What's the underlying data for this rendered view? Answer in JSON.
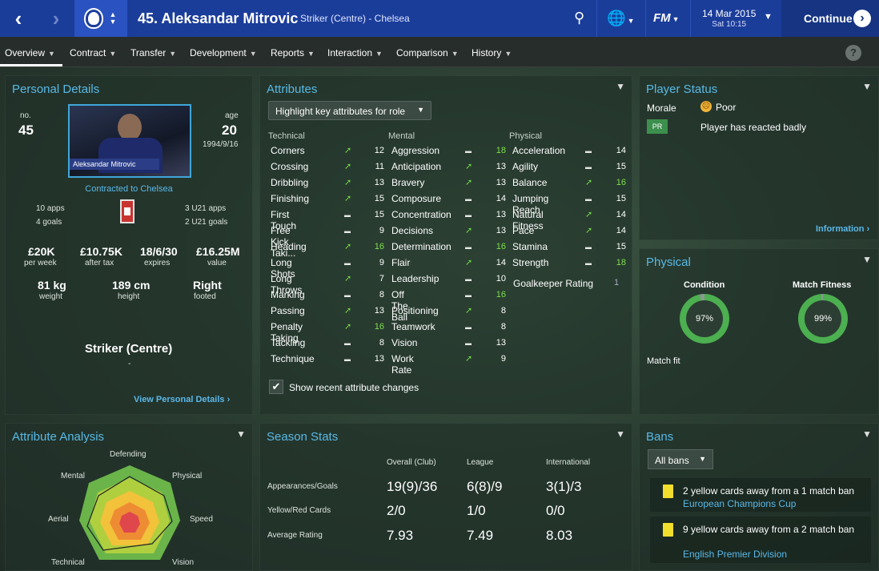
{
  "header": {
    "title": "45. Aleksandar Mitrovic",
    "subtitle": "Striker (Centre) - Chelsea",
    "date": "14 Mar 2015",
    "time": "Sat 10:15",
    "continue": "Continue",
    "fm": "FM"
  },
  "tabs": [
    {
      "label": "Overview"
    },
    {
      "label": "Contract"
    },
    {
      "label": "Transfer"
    },
    {
      "label": "Development"
    },
    {
      "label": "Reports"
    },
    {
      "label": "Interaction"
    },
    {
      "label": "Comparison"
    },
    {
      "label": "History"
    }
  ],
  "personal": {
    "title": "Personal Details",
    "no_label": "no.",
    "no": "45",
    "age_label": "age",
    "age": "20",
    "dob": "1994/9/16",
    "photo_caption": "Aleksandar Mitrovic",
    "contracted": "Contracted to Chelsea",
    "apps": "10 apps",
    "goals": "4 goals",
    "u21_apps": "3 U21 apps",
    "u21_goals": "2 U21 goals",
    "stats": [
      {
        "value": "£20K",
        "label": "per week"
      },
      {
        "value": "£10.75K",
        "label": "after tax"
      },
      {
        "value": "18/6/30",
        "label": "expires"
      },
      {
        "value": "£16.25M",
        "label": "value"
      }
    ],
    "body": [
      {
        "value": "81 kg",
        "label": "weight"
      },
      {
        "value": "189 cm",
        "label": "height"
      },
      {
        "value": "Right",
        "label": "footed"
      }
    ],
    "position": "Striker (Centre)",
    "dash": "-",
    "link": "View Personal Details ›"
  },
  "attributes": {
    "title": "Attributes",
    "dropdown": "Highlight key attributes for role",
    "technical_header": "Technical",
    "mental_header": "Mental",
    "physical_header": "Physical",
    "technical": [
      {
        "name": "Corners",
        "value": "12",
        "ind": "up"
      },
      {
        "name": "Crossing",
        "value": "11",
        "ind": "up"
      },
      {
        "name": "Dribbling",
        "value": "13",
        "ind": "up"
      },
      {
        "name": "Finishing",
        "value": "15",
        "ind": "up"
      },
      {
        "name": "First Touch",
        "value": "15",
        "ind": "dash"
      },
      {
        "name": "Free Kick Taki...",
        "value": "9",
        "ind": "dash"
      },
      {
        "name": "Heading",
        "value": "16",
        "ind": "up"
      },
      {
        "name": "Long Shots",
        "value": "9",
        "ind": "dash"
      },
      {
        "name": "Long Throws",
        "value": "7",
        "ind": "up"
      },
      {
        "name": "Marking",
        "value": "8",
        "ind": "dash"
      },
      {
        "name": "Passing",
        "value": "13",
        "ind": "up"
      },
      {
        "name": "Penalty Taking",
        "value": "16",
        "ind": "up"
      },
      {
        "name": "Tackling",
        "value": "8",
        "ind": "dash"
      },
      {
        "name": "Technique",
        "value": "13",
        "ind": "dash"
      }
    ],
    "mental": [
      {
        "name": "Aggression",
        "value": "18",
        "ind": "dash"
      },
      {
        "name": "Anticipation",
        "value": "13",
        "ind": "up"
      },
      {
        "name": "Bravery",
        "value": "13",
        "ind": "up"
      },
      {
        "name": "Composure",
        "value": "14",
        "ind": "dash"
      },
      {
        "name": "Concentration",
        "value": "13",
        "ind": "dash"
      },
      {
        "name": "Decisions",
        "value": "13",
        "ind": "up"
      },
      {
        "name": "Determination",
        "value": "16",
        "ind": "dash"
      },
      {
        "name": "Flair",
        "value": "14",
        "ind": "up"
      },
      {
        "name": "Leadership",
        "value": "10",
        "ind": "dash"
      },
      {
        "name": "Off The Ball",
        "value": "16",
        "ind": "dash"
      },
      {
        "name": "Positioning",
        "value": "8",
        "ind": "up"
      },
      {
        "name": "Teamwork",
        "value": "8",
        "ind": "dash"
      },
      {
        "name": "Vision",
        "value": "13",
        "ind": "dash"
      },
      {
        "name": "Work Rate",
        "value": "9",
        "ind": "up"
      }
    ],
    "physical": [
      {
        "name": "Acceleration",
        "value": "14",
        "ind": "dash"
      },
      {
        "name": "Agility",
        "value": "15",
        "ind": "dash"
      },
      {
        "name": "Balance",
        "value": "16",
        "ind": "up"
      },
      {
        "name": "Jumping Reach",
        "value": "15",
        "ind": "dash"
      },
      {
        "name": "Natural Fitness",
        "value": "14",
        "ind": "up"
      },
      {
        "name": "Pace",
        "value": "14",
        "ind": "up"
      },
      {
        "name": "Stamina",
        "value": "15",
        "ind": "dash"
      },
      {
        "name": "Strength",
        "value": "18",
        "ind": "dash"
      }
    ],
    "gk_label": "Goalkeeper Rating",
    "gk_value": "1",
    "recent": "Show recent attribute changes"
  },
  "status": {
    "title": "Player Status",
    "morale_label": "Morale",
    "morale": "Poor",
    "badge": "PR",
    "note": "Player has reacted badly",
    "link": "Information ›"
  },
  "physical": {
    "title": "Physical",
    "condition_label": "Condition",
    "condition": "97%",
    "condition_value": 0.97,
    "fitness_label": "Match Fitness",
    "fitness": "99%",
    "fitness_value": 0.99,
    "status": "Match fit"
  },
  "analysis": {
    "title": "Attribute Analysis",
    "labels": [
      "Defending",
      "Physical",
      "Speed",
      "Vision",
      "Technical",
      "Aerial",
      "Mental"
    ]
  },
  "season": {
    "title": "Season Stats",
    "cols": [
      "Overall (Club)",
      "League",
      "International"
    ],
    "rows": [
      {
        "label": "Appearances/Goals",
        "values": [
          "19(9)/36",
          "6(8)/9",
          "3(1)/3"
        ]
      },
      {
        "label": "Yellow/Red Cards",
        "values": [
          "2/0",
          "1/0",
          "0/0"
        ]
      },
      {
        "label": "Average Rating",
        "values": [
          "7.93",
          "7.49",
          "8.03"
        ]
      }
    ]
  },
  "bans": {
    "title": "Bans",
    "dropdown": "All bans",
    "items": [
      {
        "text": "2 yellow cards away from a 1 match ban",
        "comp": "European Champions Cup"
      },
      {
        "text": "9 yellow cards away from a 2 match ban",
        "comp": "English Premier Division"
      }
    ]
  },
  "colors": {
    "accent": "#58b9e6",
    "header": "#1b3d9a",
    "up": "#6fd246",
    "donut": "#4caf50"
  }
}
